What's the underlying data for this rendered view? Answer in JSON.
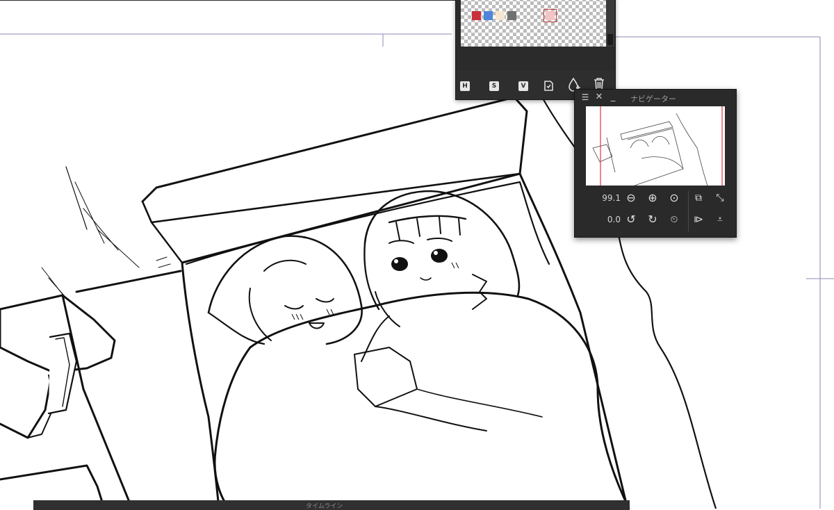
{
  "palette": {
    "swatches": [
      {
        "name": "swatch-red",
        "color": "#c8303a"
      },
      {
        "name": "swatch-blue",
        "color": "#4d86d8"
      },
      {
        "name": "swatch-cream",
        "color": "#f6e6cf"
      },
      {
        "name": "swatch-gray",
        "color": "#707070"
      },
      {
        "name": "swatch-pink-selected",
        "color": "#f2c4c4"
      }
    ],
    "toolbar": {
      "h_label": "H",
      "s_label": "S",
      "v_label": "V"
    }
  },
  "navigator": {
    "title": "ナビゲーター",
    "zoom_value": "99.1",
    "rotation_value": "0.0",
    "icons": {
      "menu": "menu-icon",
      "close": "close-icon",
      "minimize": "minimize-icon",
      "zoom_out": "zoom-out-icon",
      "zoom_in": "zoom-in-icon",
      "fit": "fit-screen-icon",
      "actual_size": "actual-size-icon",
      "expand": "expand-icon",
      "rotate_left": "rotate-left-icon",
      "rotate_right": "rotate-right-icon",
      "reset_rotation": "reset-rotation-icon",
      "flip_horizontal": "flip-horizontal-icon",
      "flip_vertical": "flip-vertical-icon"
    }
  },
  "timeline": {
    "title": "タイムライン"
  }
}
